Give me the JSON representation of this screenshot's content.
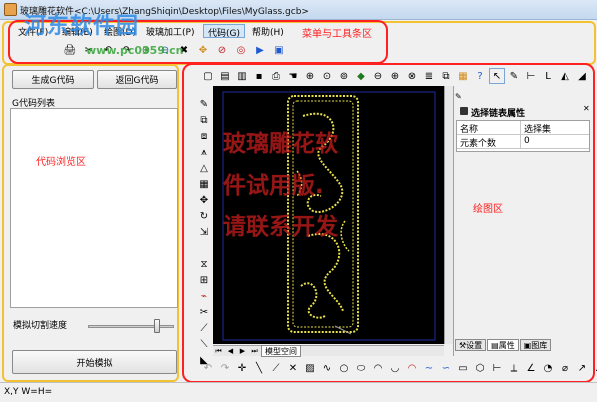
{
  "window": {
    "title": "玻璃雕花软件<C:\\Users\\ZhangShiqin\\Desktop\\Files\\MyGlass.gcb>"
  },
  "watermark": {
    "logo": "河东软件园",
    "url": "www.pc0359.cn"
  },
  "menu": {
    "items": [
      {
        "label": "文件(F)"
      },
      {
        "label": "编辑(E)"
      },
      {
        "label": "绘图(D)"
      },
      {
        "label": "玻璃加工(P)"
      },
      {
        "label": "代码(G)"
      },
      {
        "label": "帮助(H)"
      }
    ],
    "active_index": 4
  },
  "annotations": {
    "menu_toolbar": "菜单与工具条区",
    "code_browser": "代码浏览区",
    "drawing_area": "绘图区"
  },
  "left_panel": {
    "generate_label": "生成G代码",
    "return_label": "返回G代码",
    "list_header": "G代码列表",
    "speed_label": "模拟切割速度",
    "speed_level": 0.82,
    "simulate_label": "开始模拟"
  },
  "canvas": {
    "overlay_text": [
      "玻璃雕花软",
      "件试用版.",
      "请联系开发"
    ],
    "tab_label": "模型空间"
  },
  "properties": {
    "title": "选择链表属性",
    "rows": [
      {
        "name": "名称",
        "value": "选择集"
      },
      {
        "name": "元素个数",
        "value": "0"
      }
    ],
    "tabs": [
      {
        "label": "设置",
        "icon": "tools-icon"
      },
      {
        "label": "属性",
        "icon": "properties-icon"
      },
      {
        "label": "图库",
        "icon": "library-icon"
      }
    ],
    "active_tab": 1
  },
  "status": {
    "coords": "X,Y W=H="
  },
  "colors": {
    "accent_red": "#ff2020",
    "frame_yellow": "#f2c232",
    "canvas_bg": "#000000",
    "ornament": "#e8e04a"
  }
}
